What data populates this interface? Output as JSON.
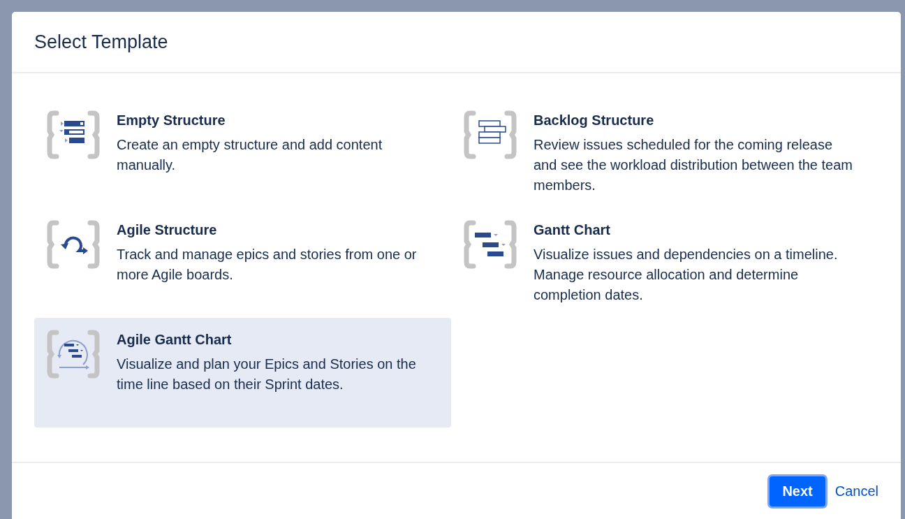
{
  "dialog": {
    "title": "Select Template"
  },
  "templates": [
    {
      "kind": "list",
      "title": "Empty Structure",
      "description": "Create an empty structure and add content manually.",
      "selected": false
    },
    {
      "kind": "backlog",
      "title": "Backlog Structure",
      "description": "Review issues scheduled for the coming release and see the workload distribution between the team members.",
      "selected": false
    },
    {
      "kind": "agile",
      "title": "Agile Structure",
      "description": "Track and manage epics and stories from one or more Agile boards.",
      "selected": false
    },
    {
      "kind": "gantt",
      "title": "Gantt Chart",
      "description": "Visualize issues and dependencies on a timeline. Manage resource allocation and determine completion dates.",
      "selected": false
    },
    {
      "kind": "agile-gantt",
      "title": "Agile Gantt Chart",
      "description": "Visualize and plan your Epics and Stories on the time line based on their Sprint dates.",
      "selected": true
    }
  ],
  "buttons": {
    "primary": "Next",
    "secondary": "Cancel"
  }
}
